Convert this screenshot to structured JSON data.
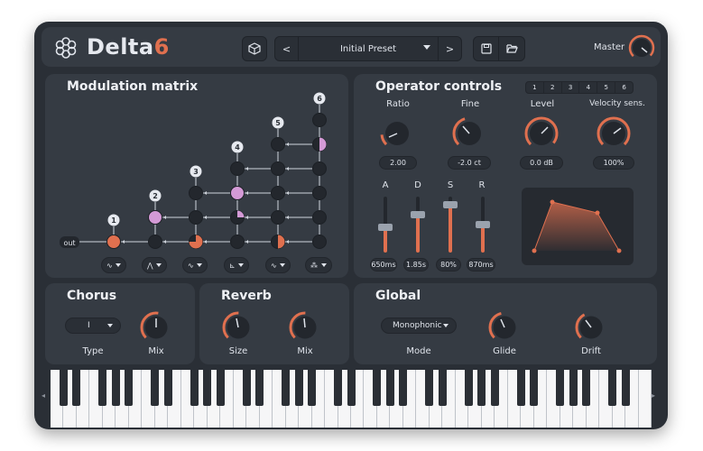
{
  "app": {
    "brand_main": "Delta",
    "brand_num": "6"
  },
  "header": {
    "preset_name": "Initial Preset",
    "prev_label": "<",
    "next_label": ">",
    "master_label": "Master"
  },
  "mod_matrix": {
    "title": "Modulation matrix",
    "out_label": "out",
    "operators": [
      "1",
      "2",
      "3",
      "4",
      "5",
      "6"
    ],
    "waveforms": [
      "sine",
      "triangle",
      "sine",
      "saw",
      "sine",
      "noise"
    ]
  },
  "operator_controls": {
    "title": "Operator controls",
    "tabs": [
      "1",
      "2",
      "3",
      "4",
      "5",
      "6"
    ],
    "knobs": [
      {
        "label": "Ratio",
        "value": "2.00"
      },
      {
        "label": "Fine",
        "value": "-2.0 ct"
      },
      {
        "label": "Level",
        "value": "0.0 dB"
      },
      {
        "label": "Velocity sens.",
        "value": "100%"
      }
    ],
    "adsr": [
      {
        "label": "A",
        "value": "650ms"
      },
      {
        "label": "D",
        "value": "1.85s"
      },
      {
        "label": "S",
        "value": "80%"
      },
      {
        "label": "R",
        "value": "870ms"
      }
    ]
  },
  "chorus": {
    "title": "Chorus",
    "type_value": "I",
    "type_label": "Type",
    "mix_label": "Mix"
  },
  "reverb": {
    "title": "Reverb",
    "size_label": "Size",
    "mix_label": "Mix"
  },
  "global": {
    "title": "Global",
    "mode_value": "Monophonic",
    "mode_label": "Mode",
    "glide_label": "Glide",
    "drift_label": "Drift"
  },
  "colors": {
    "accent": "#e0704f",
    "mod": "#d49ad6",
    "panel": "#353b43",
    "bg": "#2a2f36"
  }
}
